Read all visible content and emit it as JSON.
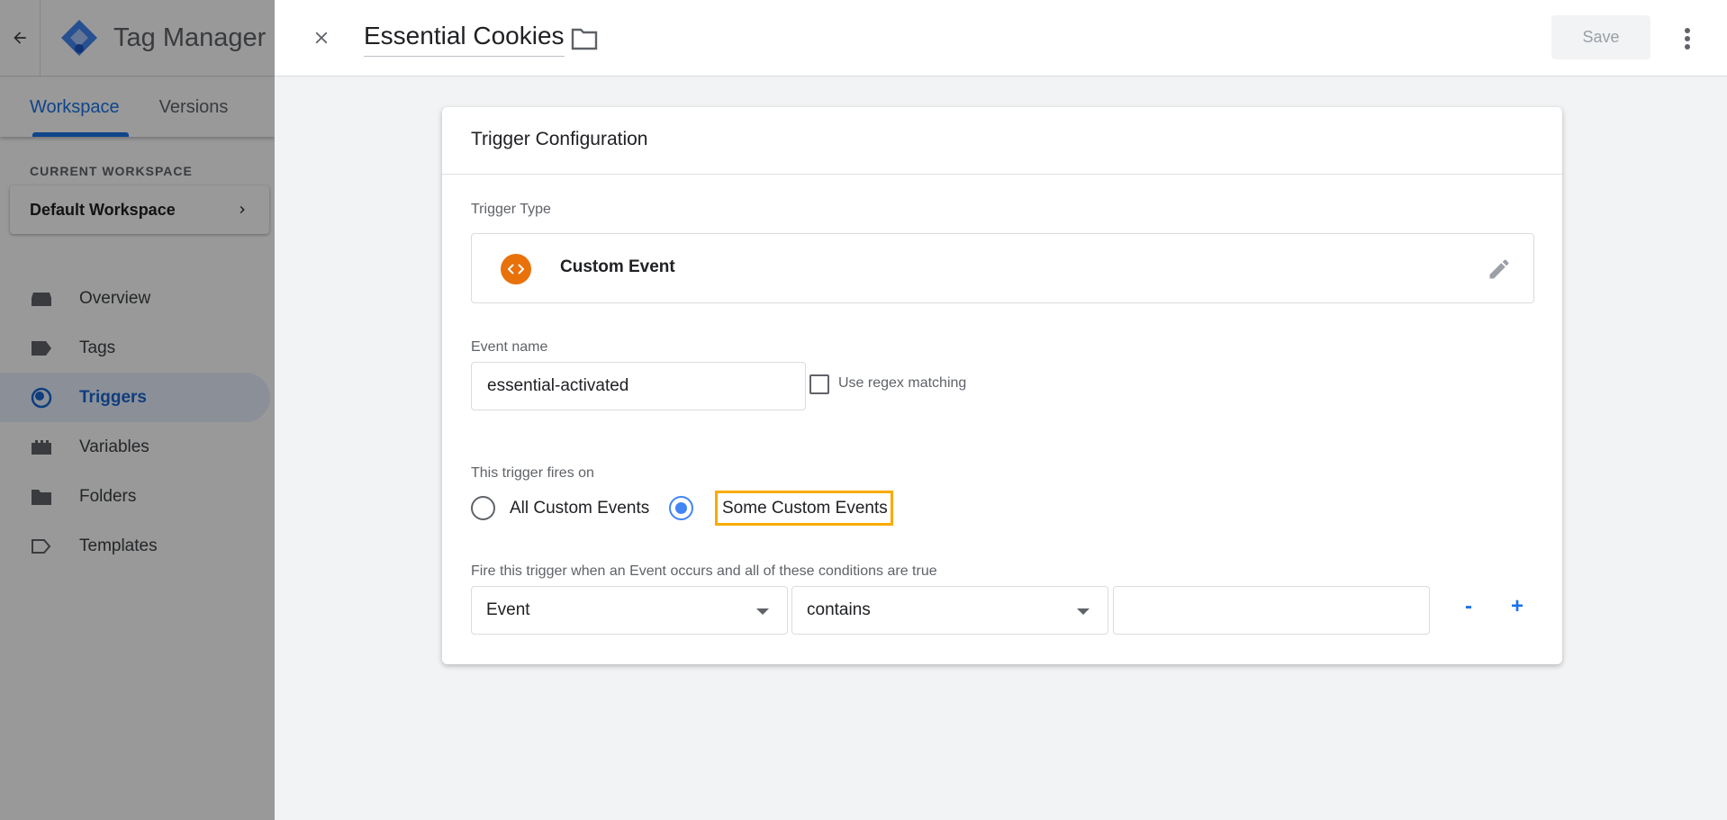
{
  "sidebar": {
    "app_title": "Tag Manager",
    "tabs": [
      {
        "label": "Workspace"
      },
      {
        "label": "Versions"
      }
    ],
    "current_workspace_label": "CURRENT WORKSPACE",
    "current_workspace_name": "Default Workspace",
    "nav": [
      {
        "label": "Overview",
        "icon": "overview-icon"
      },
      {
        "label": "Tags",
        "icon": "tag-icon"
      },
      {
        "label": "Triggers",
        "icon": "trigger-icon"
      },
      {
        "label": "Variables",
        "icon": "variables-icon"
      },
      {
        "label": "Folders",
        "icon": "folder-icon"
      },
      {
        "label": "Templates",
        "icon": "template-icon"
      }
    ]
  },
  "header": {
    "name": "Essential Cookies",
    "save_label": "Save"
  },
  "card": {
    "title": "Trigger Configuration",
    "trigger_type_label": "Trigger Type",
    "trigger_type_value": "Custom Event",
    "event_name_label": "Event name",
    "event_name_value": "essential-activated",
    "regex_label": "Use regex matching",
    "fires_on_label": "This trigger fires on",
    "fires_on_options": [
      "All Custom Events",
      "Some Custom Events"
    ],
    "condition_label": "Fire this trigger when an Event occurs and all of these conditions are true",
    "condition": {
      "variable": "Event",
      "operator": "contains",
      "value": ""
    },
    "minus_label": "-",
    "plus_label": "+"
  },
  "colors": {
    "accent": "#1a73e8",
    "trigger_icon": "#e8710a",
    "highlight": "#f9ab00"
  }
}
